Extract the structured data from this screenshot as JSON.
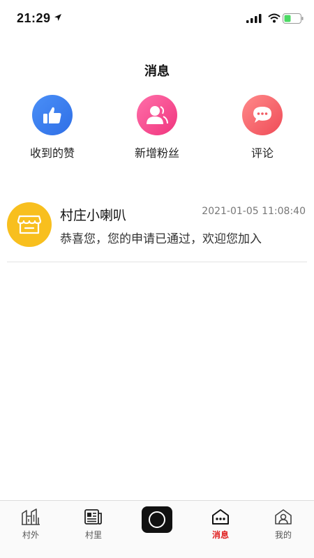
{
  "status_bar": {
    "time": "21:29"
  },
  "header": {
    "title": "消息"
  },
  "categories": [
    {
      "label": "收到的赞",
      "icon": "thumbs-up-icon",
      "color": "#3b7cf0"
    },
    {
      "label": "新增粉丝",
      "icon": "user-add-icon",
      "color": "#f34a8c"
    },
    {
      "label": "评论",
      "icon": "comment-icon",
      "color": "#f05a62"
    }
  ],
  "messages": [
    {
      "sender": "村庄小喇叭",
      "time": "2021-01-05 11:08:40",
      "preview": "恭喜您，您的申请已通过，欢迎您加入",
      "avatar_icon": "store-icon",
      "avatar_color": "#f8bf1e"
    }
  ],
  "tab_bar": {
    "items": [
      {
        "label": "村外",
        "icon": "building-icon"
      },
      {
        "label": "村里",
        "icon": "newspaper-icon"
      },
      {
        "label": "",
        "icon": "camera-icon"
      },
      {
        "label": "消息",
        "icon": "message-house-icon",
        "active": true
      },
      {
        "label": "我的",
        "icon": "profile-house-icon"
      }
    ],
    "active_color": "#e02020"
  }
}
